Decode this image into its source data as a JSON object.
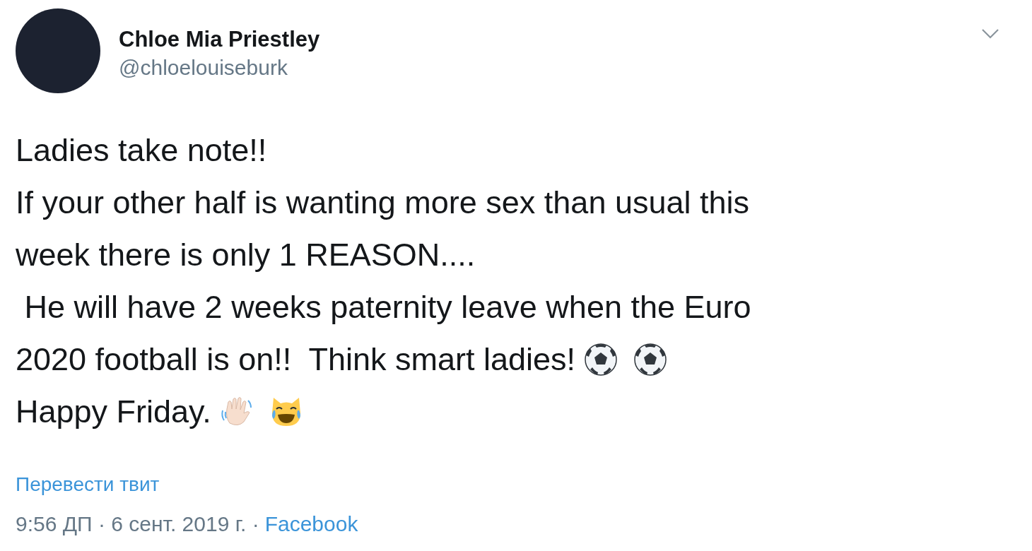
{
  "tweet": {
    "author": {
      "name": "Chloe Mia Priestley",
      "handle": "@chloelouiseburk"
    },
    "body": [
      {
        "segments": [
          {
            "kind": "text",
            "text": "Ladies take note!!"
          }
        ]
      },
      {
        "segments": [
          {
            "kind": "text",
            "text": "If your other half is wanting more sex than usual this"
          }
        ]
      },
      {
        "segments": [
          {
            "kind": "text",
            "text": "week there is only 1 REASON...."
          }
        ]
      },
      {
        "segments": [
          {
            "kind": "text",
            "text": " He will have 2 weeks paternity leave when the Euro"
          }
        ]
      },
      {
        "segments": [
          {
            "kind": "text",
            "text": "2020 football is on!!  Think smart ladies!"
          },
          {
            "kind": "ball"
          },
          {
            "kind": "ball"
          }
        ]
      },
      {
        "segments": [
          {
            "kind": "text",
            "text": "Happy Friday."
          },
          {
            "kind": "wave"
          },
          {
            "kind": "cat"
          }
        ]
      }
    ],
    "translate_link": "Перевести твит",
    "time": "9:56 ДП · 6 сент. 2019 г. ·",
    "source": "Facebook"
  }
}
